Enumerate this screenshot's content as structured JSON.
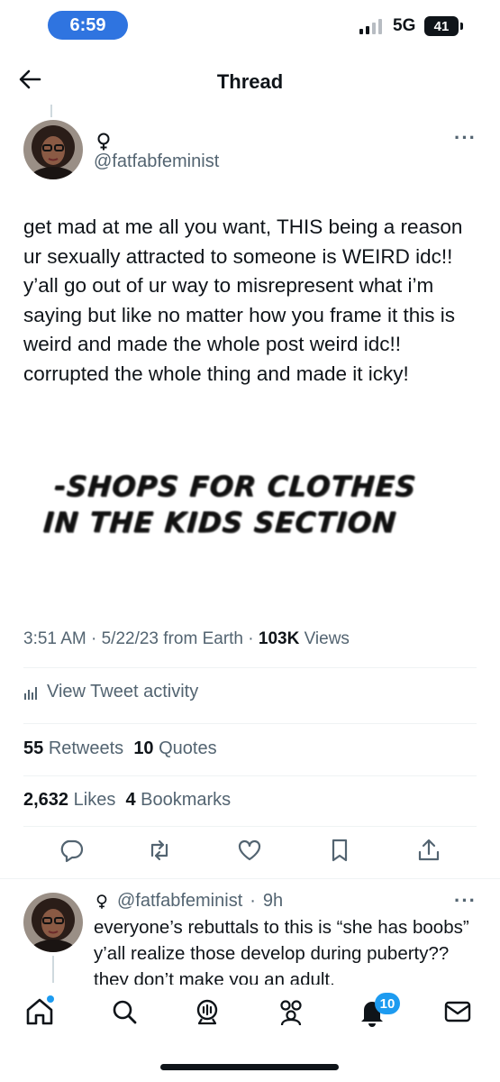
{
  "status_bar": {
    "time": "6:59",
    "network": "5G",
    "battery": "41"
  },
  "nav": {
    "title": "Thread"
  },
  "tweet": {
    "handle": "@fatfabfeminist",
    "text": "get mad at me all you want, THIS being a reason ur sexually attracted to someone is WEIRD idc!! y’all go out of ur way to misrepresent what i’m saying but like no matter how you frame it this is weird and made the whole post weird idc!! corrupted the whole thing and made it icky!",
    "image_text": {
      "line1": "-SHOPS FOR CLOTHES",
      "line2": "IN THE KIDS SECTION"
    },
    "meta": {
      "time": "3:51 AM",
      "date": "5/22/23",
      "source": "from Earth",
      "views_count": "103K",
      "views_label": "Views"
    },
    "activity_label": "View Tweet activity",
    "stats": {
      "retweets_count": "55",
      "retweets_label": "Retweets",
      "quotes_count": "10",
      "quotes_label": "Quotes",
      "likes_count": "2,632",
      "likes_label": "Likes",
      "bookmarks_count": "4",
      "bookmarks_label": "Bookmarks"
    },
    "actions": [
      "reply-icon",
      "retweet-icon",
      "like-icon",
      "bookmark-icon",
      "share-icon"
    ]
  },
  "reply": {
    "handle": "@fatfabfeminist",
    "age": "9h",
    "text": "everyone’s rebuttals to this is “she has boobs” y’all realize those develop during puberty?? they don’t make you an adult."
  },
  "tab_bar": {
    "items": [
      "home-icon",
      "search-icon",
      "spaces-icon",
      "communities-icon",
      "notifications-icon",
      "messages-icon"
    ],
    "notifications_badge": "10"
  },
  "colors": {
    "accent": "#1d9bf0",
    "secondary_text": "#536471",
    "time_pill": "#2f74e0"
  }
}
